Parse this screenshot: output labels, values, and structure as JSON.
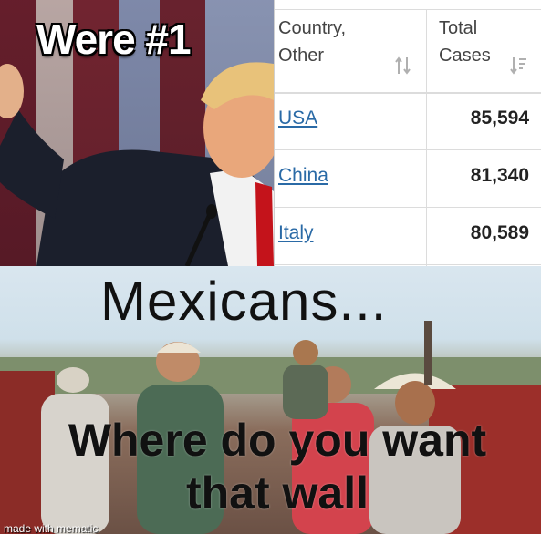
{
  "top_caption": "Were #1",
  "table": {
    "headers": {
      "country": "Country,\nOther",
      "cases": "Total\nCases"
    },
    "rows": [
      {
        "country": "USA",
        "cases": "85,594"
      },
      {
        "country": "China",
        "cases": "81,340"
      },
      {
        "country": "Italy",
        "cases": "80,589"
      }
    ],
    "link_color": "#2a6aa6"
  },
  "bottom_caption": {
    "line1": "Mexicans...",
    "line2": "Where do you want that wall"
  },
  "watermark": "made with mematic",
  "icons": [
    "sort-arrows-icon",
    "sort-descending-icon"
  ]
}
